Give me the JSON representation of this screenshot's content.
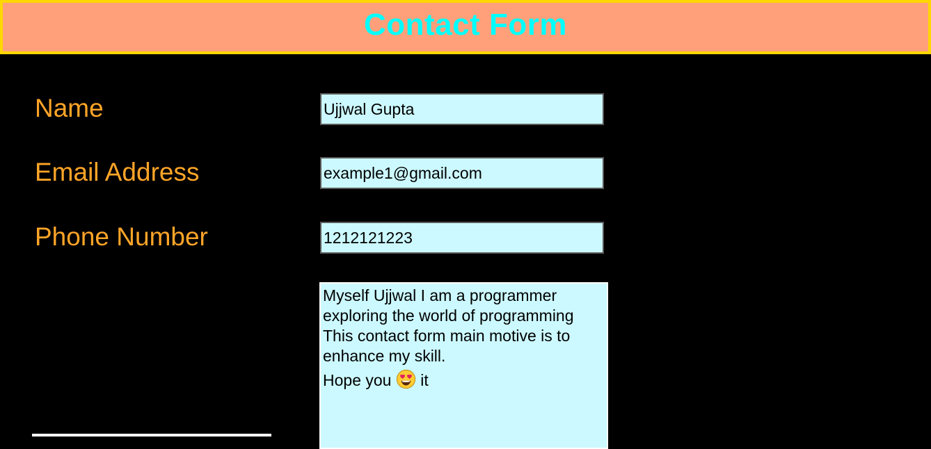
{
  "header": {
    "title": "Contact Form"
  },
  "form": {
    "name": {
      "label": "Name",
      "value": "Ujjwal Gupta"
    },
    "email": {
      "label": "Email Address",
      "value": "example1@gmail.com"
    },
    "phone": {
      "label": "Phone Number",
      "value": "1212121223"
    },
    "message": {
      "lines": [
        "Myself Ujjwal I am a programmer",
        "exploring the world of programming",
        "This contact form main motive is to",
        "enhance my skill."
      ],
      "last_line_before_emoji": "Hope you",
      "last_line_after_emoji": "it",
      "emoji_icon": "heart-eyes-icon"
    }
  },
  "colors": {
    "background": "#000000",
    "header_bg": "#FFA07A",
    "header_border": "#FFD700",
    "title": "#00FFFF",
    "label": "#FFA528",
    "field_bg": "#CCF9FF"
  }
}
